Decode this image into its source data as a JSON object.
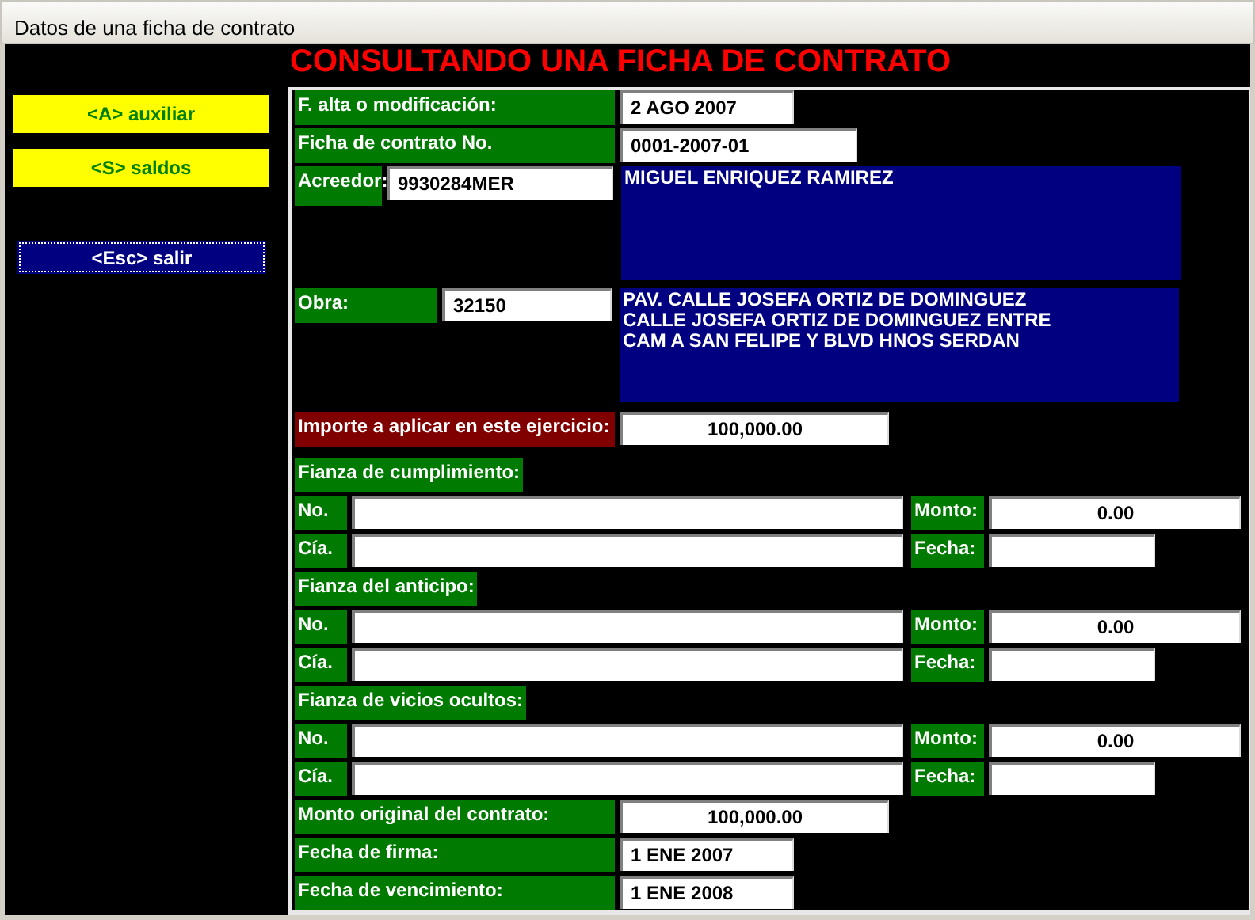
{
  "window": {
    "title": "Datos de una ficha de contrato"
  },
  "sidebar": {
    "buttons": [
      {
        "label": "<A> auxiliar",
        "kind": "shortcut",
        "focused": false
      },
      {
        "label": "<S> saldos",
        "kind": "shortcut",
        "focused": false
      },
      {
        "label": "<Esc> salir",
        "kind": "exit",
        "focused": true
      }
    ]
  },
  "heading": "CONSULTANDO UNA FICHA DE CONTRATO",
  "alta": {
    "label": "F. alta o modificación:",
    "value": "2 AGO 2007"
  },
  "ficha": {
    "label": "Ficha de contrato No.",
    "value": "0001-2007-01"
  },
  "acreedor": {
    "label": "Acreedor:",
    "code": "9930284MER",
    "name_lines": [
      "MIGUEL ENRIQUEZ RAMIREZ"
    ]
  },
  "obra": {
    "label": "Obra:",
    "code": "32150",
    "description_lines": [
      "PAV. CALLE JOSEFA ORTIZ DE DOMINGUEZ",
      "CALLE JOSEFA ORTIZ DE DOMINGUEZ ENTRE",
      "CAM A SAN FELIPE Y BLVD HNOS SERDAN"
    ]
  },
  "importe": {
    "label": "Importe a aplicar en este ejercicio:",
    "value": "100,000.00"
  },
  "fianzas": [
    {
      "title": "Fianza de cumplimiento:",
      "no_label": "No.",
      "cia_label": "Cía.",
      "monto_label": "Monto:",
      "monto": "0.00",
      "fecha_label": "Fecha:"
    },
    {
      "title": "Fianza del anticipo:",
      "no_label": "No.",
      "cia_label": "Cía.",
      "monto_label": "Monto:",
      "monto": "0.00",
      "fecha_label": "Fecha:"
    },
    {
      "title": "Fianza de vicios ocultos:",
      "no_label": "No.",
      "cia_label": "Cía.",
      "monto_label": "Monto:",
      "monto": "0.00",
      "fecha_label": "Fecha:"
    }
  ],
  "monto_original": {
    "label": "Monto original del contrato:",
    "value": "100,000.00"
  },
  "fecha_firma": {
    "label": "Fecha de firma:",
    "value": "1 ENE 2007"
  },
  "fecha_vencimiento": {
    "label": "Fecha de vencimiento:",
    "value": "1 ENE 2008"
  }
}
